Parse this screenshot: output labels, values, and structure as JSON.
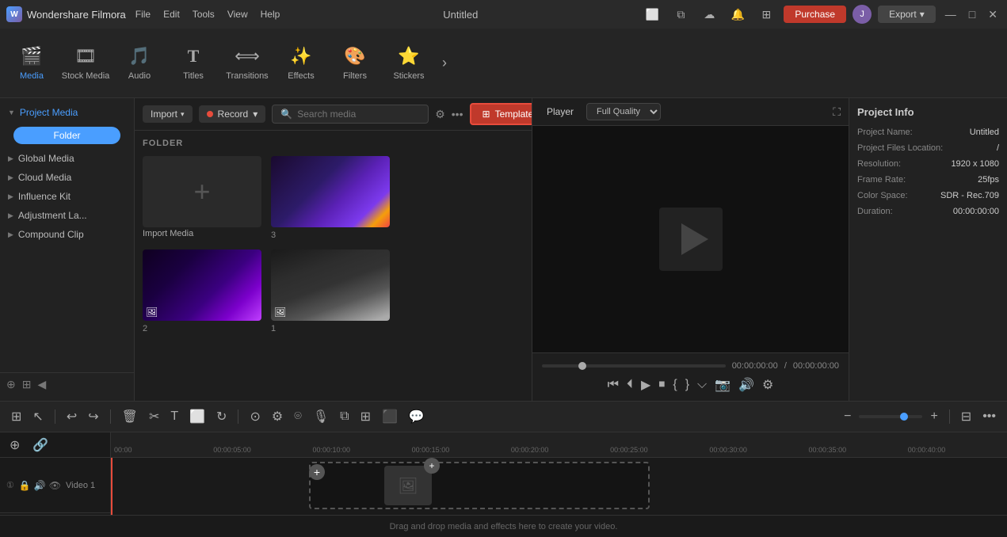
{
  "app": {
    "name": "Wondershare Filmora",
    "title": "Untitled"
  },
  "titlebar": {
    "menu_items": [
      "File",
      "Edit",
      "Tools",
      "View",
      "Help"
    ],
    "purchase_label": "Purchase",
    "export_label": "Export",
    "user_initial": "J"
  },
  "toolbar": {
    "items": [
      {
        "id": "media",
        "label": "Media",
        "icon": "🎬",
        "active": true
      },
      {
        "id": "stock-media",
        "label": "Stock Media",
        "icon": "🎞"
      },
      {
        "id": "audio",
        "label": "Audio",
        "icon": "🎵"
      },
      {
        "id": "titles",
        "label": "Titles",
        "icon": "T"
      },
      {
        "id": "transitions",
        "label": "Transitions",
        "icon": "⟺"
      },
      {
        "id": "effects",
        "label": "Effects",
        "icon": "✨"
      },
      {
        "id": "filters",
        "label": "Filters",
        "icon": "🎨"
      },
      {
        "id": "stickers",
        "label": "Stickers",
        "icon": "⭐"
      }
    ]
  },
  "sidebar": {
    "items": [
      {
        "id": "project-media",
        "label": "Project Media",
        "expandable": true,
        "active": true
      },
      {
        "id": "folder",
        "label": "Folder"
      },
      {
        "id": "global-media",
        "label": "Global Media",
        "expandable": true
      },
      {
        "id": "cloud-media",
        "label": "Cloud Media",
        "expandable": true
      },
      {
        "id": "influence-kit",
        "label": "Influence Kit",
        "expandable": true
      },
      {
        "id": "adjustment-la",
        "label": "Adjustment La...",
        "expandable": true
      },
      {
        "id": "compound-clip",
        "label": "Compound Clip",
        "expandable": true
      }
    ]
  },
  "media_panel": {
    "import_label": "Import",
    "record_label": "Record",
    "search_placeholder": "Search media",
    "templates_label": "Templates",
    "folder_header": "FOLDER",
    "items": [
      {
        "id": "import-media",
        "label": "Import Media",
        "type": "add",
        "count": ""
      },
      {
        "id": "thumb1",
        "label": "3",
        "type": "image",
        "style": "dark-purple"
      },
      {
        "id": "thumb2",
        "label": "2",
        "type": "image",
        "style": "purple-stage"
      },
      {
        "id": "thumb3",
        "label": "1",
        "type": "image",
        "style": "dark-hands"
      }
    ]
  },
  "preview": {
    "tab_player": "Player",
    "quality_label": "Full Quality",
    "time_current": "00:00:00:00",
    "time_separator": "/",
    "time_total": "00:00:00:00"
  },
  "project_info": {
    "title": "Project Info",
    "fields": [
      {
        "label": "Project Name:",
        "value": "Untitled"
      },
      {
        "label": "Project Files Location:",
        "value": "/"
      },
      {
        "label": "Resolution:",
        "value": "1920 x 1080"
      },
      {
        "label": "Frame Rate:",
        "value": "25fps"
      },
      {
        "label": "Color Space:",
        "value": "SDR - Rec.709"
      },
      {
        "label": "Duration:",
        "value": "00:00:00:00"
      }
    ]
  },
  "timeline": {
    "ruler_marks": [
      "00:00",
      "00:00:05:00",
      "00:00:10:00",
      "00:00:15:00",
      "00:00:20:00",
      "00:00:25:00",
      "00:00:30:00",
      "00:00:35:00",
      "00:00:40:00"
    ],
    "track_name": "Video 1",
    "drop_text": "Drag and drop media and effects here to create your video."
  }
}
